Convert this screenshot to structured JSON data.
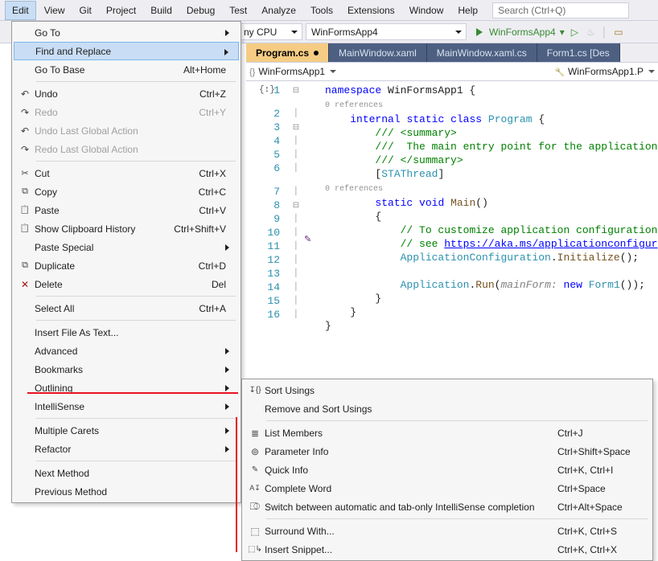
{
  "menubar": {
    "items": [
      "Edit",
      "View",
      "Git",
      "Project",
      "Build",
      "Debug",
      "Test",
      "Analyze",
      "Tools",
      "Extensions",
      "Window",
      "Help"
    ],
    "active": "Edit",
    "search_placeholder": "Search (Ctrl+Q)"
  },
  "toolbar": {
    "config": "ny CPU",
    "project": "WinFormsApp4",
    "run_label": "WinFormsApp4"
  },
  "tabs": [
    {
      "label": "Program.cs",
      "active": true,
      "dirty": true
    },
    {
      "label": "MainWindow.xaml",
      "active": false
    },
    {
      "label": "MainWindow.xaml.cs",
      "active": false
    },
    {
      "label": "Form1.cs [Des",
      "active": false
    }
  ],
  "breadcrumb": {
    "project": "WinFormsApp1",
    "right": "WinFormsApp1.P"
  },
  "edit_menu": [
    {
      "type": "item",
      "label": "Go To",
      "submenu": true
    },
    {
      "type": "item",
      "label": "Find and Replace",
      "submenu": true,
      "highlight": true
    },
    {
      "type": "item",
      "label": "Go To Base",
      "shortcut": "Alt+Home"
    },
    {
      "type": "sep"
    },
    {
      "type": "item",
      "icon": "i-undo",
      "label": "Undo",
      "shortcut": "Ctrl+Z"
    },
    {
      "type": "item",
      "icon": "i-redo",
      "label": "Redo",
      "shortcut": "Ctrl+Y",
      "disabled": true
    },
    {
      "type": "item",
      "icon": "i-undo",
      "label": "Undo Last Global Action",
      "disabled": true
    },
    {
      "type": "item",
      "icon": "i-redo",
      "label": "Redo Last Global Action",
      "disabled": true
    },
    {
      "type": "sep"
    },
    {
      "type": "item",
      "icon": "i-cut",
      "label": "Cut",
      "shortcut": "Ctrl+X"
    },
    {
      "type": "item",
      "icon": "i-copy",
      "label": "Copy",
      "shortcut": "Ctrl+C"
    },
    {
      "type": "item",
      "icon": "i-paste",
      "label": "Paste",
      "shortcut": "Ctrl+V"
    },
    {
      "type": "item",
      "icon": "i-clip",
      "label": "Show Clipboard History",
      "shortcut": "Ctrl+Shift+V"
    },
    {
      "type": "item",
      "label": "Paste Special",
      "submenu": true
    },
    {
      "type": "item",
      "icon": "i-dup",
      "label": "Duplicate",
      "shortcut": "Ctrl+D"
    },
    {
      "type": "item",
      "icon": "i-del",
      "label": "Delete",
      "shortcut": "Del"
    },
    {
      "type": "sep"
    },
    {
      "type": "item",
      "label": "Select All",
      "shortcut": "Ctrl+A"
    },
    {
      "type": "sep"
    },
    {
      "type": "item",
      "label": "Insert File As Text..."
    },
    {
      "type": "item",
      "label": "Advanced",
      "submenu": true
    },
    {
      "type": "item",
      "label": "Bookmarks",
      "submenu": true
    },
    {
      "type": "item",
      "label": "Outlining",
      "submenu": true
    },
    {
      "type": "item",
      "label": "IntelliSense",
      "submenu": true
    },
    {
      "type": "sep"
    },
    {
      "type": "item",
      "label": "Multiple Carets",
      "submenu": true
    },
    {
      "type": "item",
      "label": "Refactor",
      "submenu": true
    },
    {
      "type": "sep"
    },
    {
      "type": "item",
      "label": "Next Method"
    },
    {
      "type": "item",
      "label": "Previous Method"
    }
  ],
  "intellisense_submenu": [
    {
      "icon": "i-sort",
      "label": "Sort Usings"
    },
    {
      "label": "Remove and Sort Usings"
    },
    {
      "type": "sep"
    },
    {
      "icon": "i-list",
      "label": "List Members",
      "shortcut": "Ctrl+J"
    },
    {
      "icon": "i-param",
      "label": "Parameter Info",
      "shortcut": "Ctrl+Shift+Space"
    },
    {
      "icon": "i-quick",
      "label": "Quick Info",
      "shortcut": "Ctrl+K, Ctrl+I"
    },
    {
      "icon": "i-complete",
      "label": "Complete Word",
      "shortcut": "Ctrl+Space"
    },
    {
      "icon": "i-switch",
      "label": "Switch between automatic and tab-only IntelliSense completion",
      "shortcut": "Ctrl+Alt+Space"
    },
    {
      "type": "sep"
    },
    {
      "icon": "i-surround",
      "label": "Surround With...",
      "shortcut": "Ctrl+K, Ctrl+S"
    },
    {
      "icon": "i-snippet",
      "label": "Insert Snippet...",
      "shortcut": "Ctrl+K, Ctrl+X"
    }
  ],
  "code": {
    "lines": [
      1,
      2,
      3,
      4,
      5,
      6,
      7,
      8,
      9,
      10,
      11,
      12,
      13,
      14,
      15,
      16
    ],
    "ref": "0 references"
  }
}
